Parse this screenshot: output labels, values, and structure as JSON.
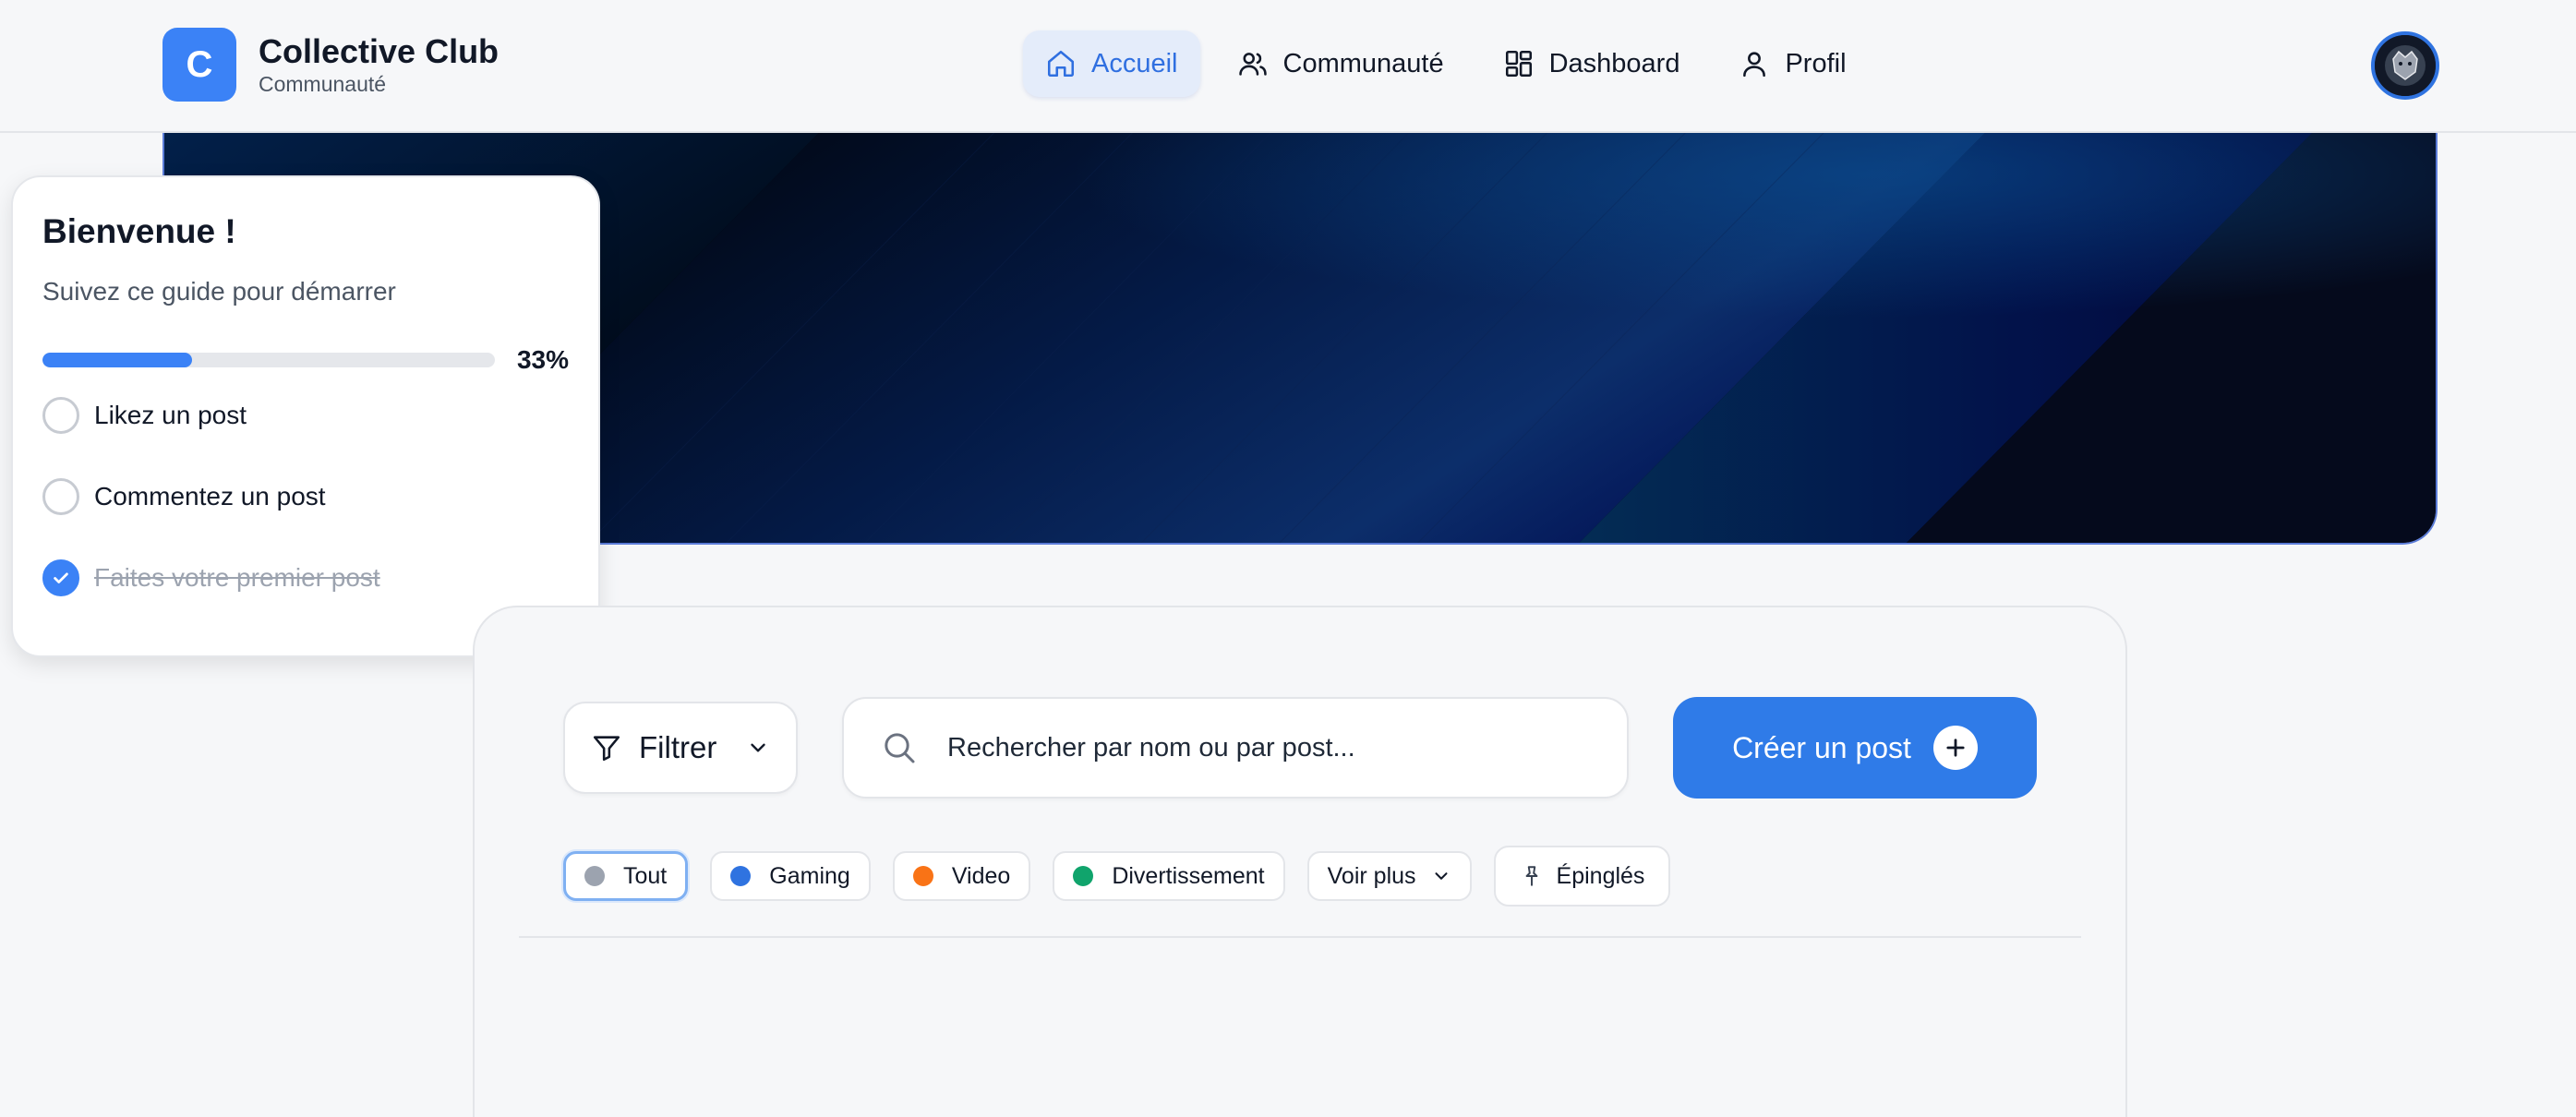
{
  "brand": {
    "logo_letter": "C",
    "title": "Collective Club",
    "subtitle": "Communauté",
    "color": "#3b82f6"
  },
  "nav": {
    "items": [
      {
        "label": "Accueil",
        "icon": "home-icon",
        "active": true
      },
      {
        "label": "Communauté",
        "icon": "users-icon",
        "active": false
      },
      {
        "label": "Dashboard",
        "icon": "dashboard-icon",
        "active": false
      },
      {
        "label": "Profil",
        "icon": "user-icon",
        "active": false
      }
    ],
    "active_color": "#2f6fe0"
  },
  "user": {
    "avatar": "avatar-icon"
  },
  "guide": {
    "title": "Bienvenue !",
    "subtitle": "Suivez ce guide pour démarrer",
    "progress_percent": 33,
    "progress_label": "33%",
    "tasks": [
      {
        "label": "Likez un post",
        "done": false
      },
      {
        "label": "Commentez un post",
        "done": false
      },
      {
        "label": "Faites votre premier post",
        "done": true
      }
    ]
  },
  "toolbar": {
    "filter_label": "Filtrer",
    "search_placeholder": "Rechercher par nom ou par post...",
    "create_label": "Créer un post",
    "accent": "#2f7be8"
  },
  "categories": {
    "items": [
      {
        "label": "Tout",
        "color": "#9ca3af",
        "active": true
      },
      {
        "label": "Gaming",
        "color": "#2f73e0",
        "active": false
      },
      {
        "label": "Video",
        "color": "#f97316",
        "active": false
      },
      {
        "label": "Divertissement",
        "color": "#10a46c",
        "active": false
      }
    ],
    "more_label": "Voir plus",
    "pinned_label": "Épinglés"
  }
}
